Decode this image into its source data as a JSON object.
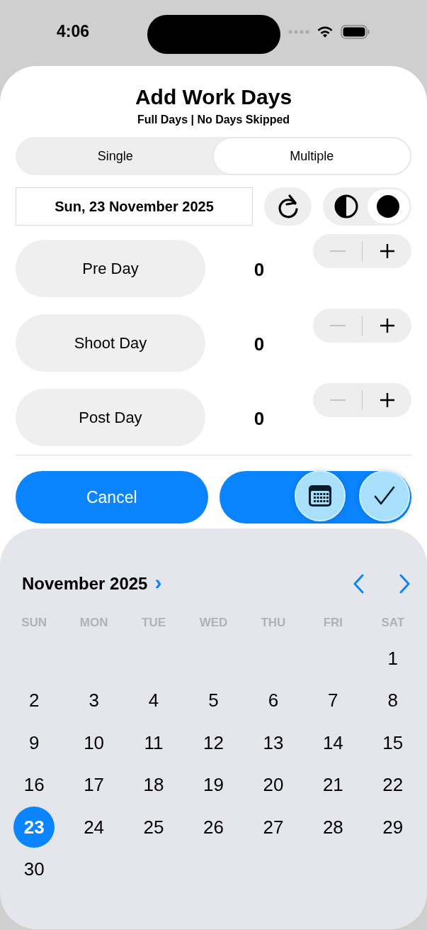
{
  "status_bar": {
    "time": "4:06"
  },
  "title": "Add Work Days",
  "subtitle": "Full Days | No Days Skipped",
  "mode_tabs": [
    {
      "label": "Single",
      "selected": false
    },
    {
      "label": "Multiple",
      "selected": true
    }
  ],
  "date_field": {
    "value": "Sun, 23 November 2025"
  },
  "appearance_options": [
    {
      "kind": "contrast",
      "selected": false
    },
    {
      "kind": "dark",
      "selected": true
    }
  ],
  "day_types": [
    {
      "label": "Pre Day",
      "count": "0",
      "minus_disabled": true
    },
    {
      "label": "Shoot Day",
      "count": "0",
      "minus_disabled": true
    },
    {
      "label": "Post Day",
      "count": "0",
      "minus_disabled": true
    }
  ],
  "cancel_button": {
    "label": "Cancel"
  },
  "calendar": {
    "month": "November 2025",
    "chevron": "›",
    "weekdays": [
      "SUN",
      "MON",
      "TUE",
      "WED",
      "THU",
      "FRI",
      "SAT"
    ],
    "weeks": [
      {
        "kind": "trailing",
        "days": [
          {
            "day": "1",
            "selected": false
          }
        ]
      },
      {
        "kind": "leading",
        "days": [
          {
            "day": "2",
            "selected": false
          },
          {
            "day": "3",
            "selected": false
          },
          {
            "day": "4",
            "selected": false
          },
          {
            "day": "5",
            "selected": false
          },
          {
            "day": "6",
            "selected": false
          },
          {
            "day": "7",
            "selected": false
          },
          {
            "day": "8",
            "selected": false
          }
        ]
      },
      {
        "kind": "leading",
        "days": [
          {
            "day": "9",
            "selected": false
          },
          {
            "day": "10",
            "selected": false
          },
          {
            "day": "11",
            "selected": false
          },
          {
            "day": "12",
            "selected": false
          },
          {
            "day": "13",
            "selected": false
          },
          {
            "day": "14",
            "selected": false
          },
          {
            "day": "15",
            "selected": false
          }
        ]
      },
      {
        "kind": "leading",
        "days": [
          {
            "day": "16",
            "selected": false
          },
          {
            "day": "17",
            "selected": false
          },
          {
            "day": "18",
            "selected": false
          },
          {
            "day": "19",
            "selected": false
          },
          {
            "day": "20",
            "selected": false
          },
          {
            "day": "21",
            "selected": false
          },
          {
            "day": "22",
            "selected": false
          }
        ]
      },
      {
        "kind": "leading",
        "days": [
          {
            "day": "23",
            "selected": true
          },
          {
            "day": "24",
            "selected": false
          },
          {
            "day": "25",
            "selected": false
          },
          {
            "day": "26",
            "selected": false
          },
          {
            "day": "27",
            "selected": false
          },
          {
            "day": "28",
            "selected": false
          },
          {
            "day": "29",
            "selected": false
          }
        ]
      },
      {
        "kind": "leading",
        "days": [
          {
            "day": "30",
            "selected": false
          }
        ]
      }
    ]
  }
}
